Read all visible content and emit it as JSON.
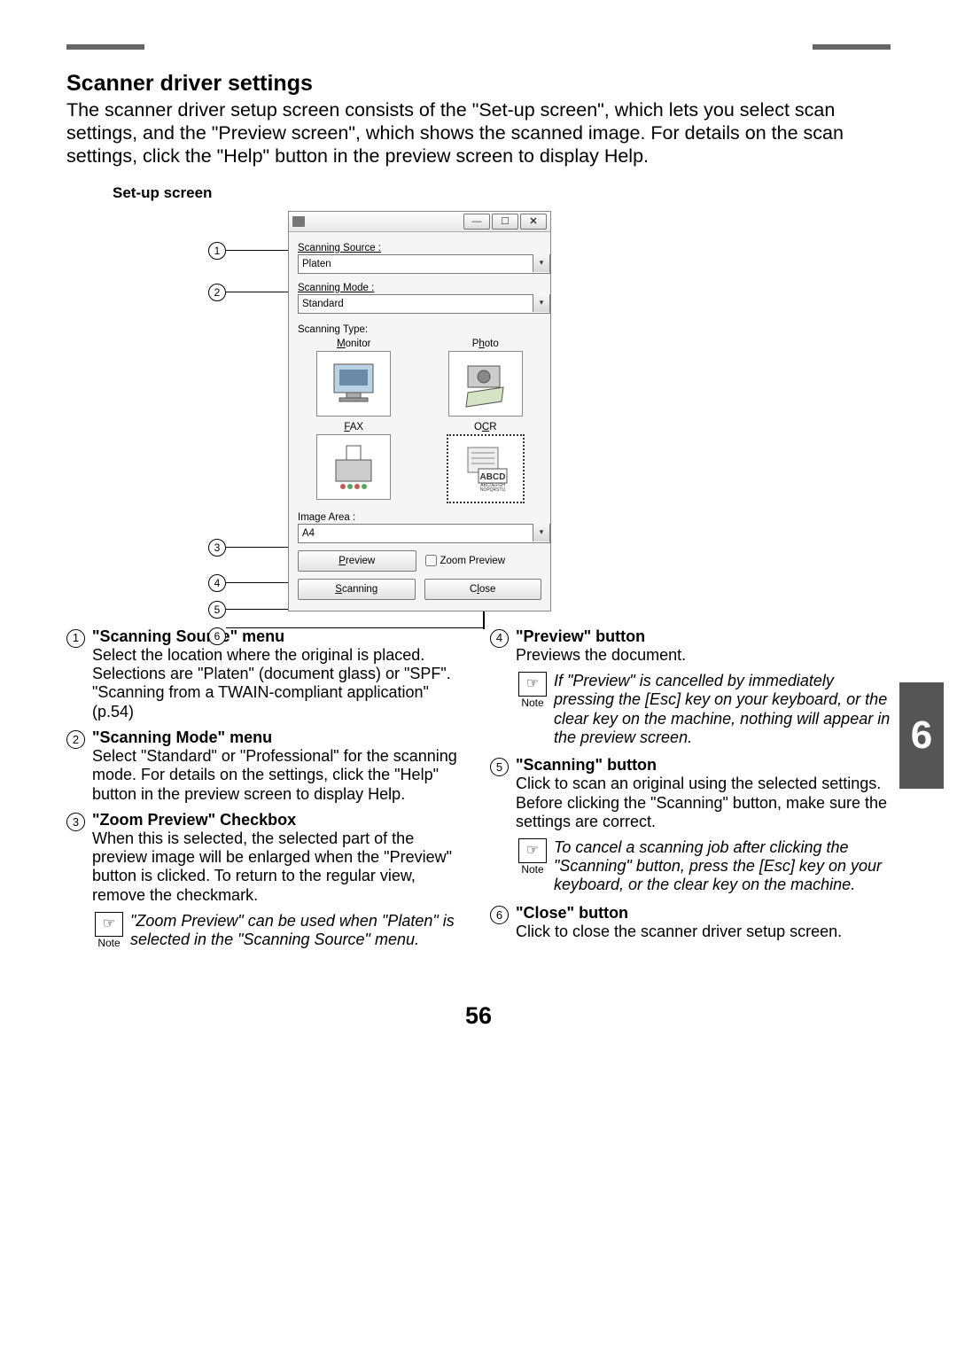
{
  "header": {
    "title": "Scanner driver settings",
    "intro": "The scanner driver setup screen consists of the \"Set-up screen\", which lets you select scan settings, and the \"Preview screen\", which shows the scanned image. For details on the scan settings, click the \"Help\" button in the preview screen to display Help.",
    "setup_label": "Set-up screen"
  },
  "dialog": {
    "scanning_source_label": "Scanning Source :",
    "scanning_source_value": "Platen",
    "scanning_mode_label": "Scanning Mode :",
    "scanning_mode_value": "Standard",
    "scanning_type_label": "Scanning Type:",
    "types": {
      "monitor": "Monitor",
      "photo": "Photo",
      "fax": "FAX",
      "ocr": "OCR"
    },
    "image_area_label": "Image Area :",
    "image_area_value": "A4",
    "preview_btn": "Preview",
    "zoom_preview": "Zoom Preview",
    "scanning_btn": "Scanning",
    "close_btn": "Close"
  },
  "callouts": [
    "1",
    "2",
    "3",
    "4",
    "5",
    "6"
  ],
  "items": {
    "i1": {
      "title": "\"Scanning Source\" menu",
      "body": "Select the location where the original is placed. Selections are \"Platen\" (document glass) or \"SPF\". \"Scanning from a TWAIN-compliant application\" (p.54)"
    },
    "i2": {
      "title": "\"Scanning Mode\" menu",
      "body": "Select \"Standard\" or \"Professional\" for the scanning mode. For details on the settings, click the \"Help\" button in the preview screen to display Help."
    },
    "i3": {
      "title": "\"Zoom Preview\" Checkbox",
      "body": "When this is selected, the selected part of the preview image will be enlarged when the \"Preview\" button is clicked. To return to the regular view, remove the checkmark."
    },
    "i3_note": "\"Zoom Preview\" can be used when \"Platen\" is selected in the \"Scanning Source\" menu.",
    "i4": {
      "title": "\"Preview\" button",
      "body": "Previews the document."
    },
    "i4_note": "If \"Preview\" is cancelled by immediately pressing the [Esc] key on your keyboard, or the clear key on the machine, nothing will appear in the preview screen.",
    "i5": {
      "title": "\"Scanning\" button",
      "body": "Click to scan an original using the selected settings. Before clicking the \"Scanning\" button, make sure the settings are correct."
    },
    "i5_note": "To cancel a scanning job after clicking the \"Scanning\" button, press the [Esc] key on your keyboard, or the clear key on the machine.",
    "i6": {
      "title": "\"Close\" button",
      "body": "Click to close the scanner driver setup screen."
    }
  },
  "note_label": "Note",
  "side_tab": "6",
  "page_number": "56"
}
